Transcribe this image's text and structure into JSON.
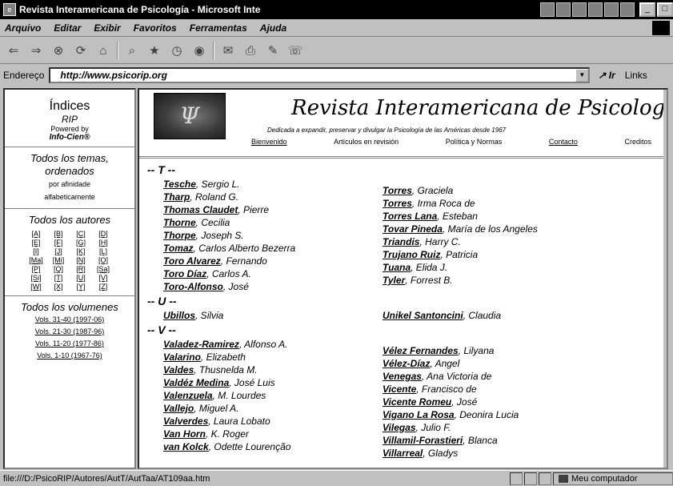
{
  "window": {
    "title": "Revista Interamericana de Psicología - Microsoft Inte",
    "controls": [
      "_",
      "□"
    ]
  },
  "menu": [
    "Arquivo",
    "Editar",
    "Exibir",
    "Favoritos",
    "Ferramentas",
    "Ajuda"
  ],
  "toolbar": {
    "icons": [
      "back-icon",
      "forward-icon",
      "stop-icon",
      "refresh-icon",
      "home-icon",
      "search-icon",
      "favorites-icon",
      "history-icon",
      "media-icon",
      "mail-icon",
      "print-icon",
      "edit-icon",
      "discuss-icon"
    ]
  },
  "address": {
    "label": "Endereço",
    "url": "http://www.psicorip.org",
    "go": "Ir",
    "links": "Links"
  },
  "sidebar": {
    "title": "Índices",
    "subtitle": "RIP",
    "powered": "Powered by",
    "brand": "Info-Cien®",
    "themes_heading": "Todos los temas, ordenados",
    "themes_note1": "por afinidade",
    "themes_note2": "alfabeticamente",
    "authors_heading": "Todos los autores",
    "letters": [
      "[A]",
      "[B]",
      "[C]",
      "[D]",
      "[E]",
      "[F]",
      "[G]",
      "[H]",
      "[I]",
      "[J]",
      "[K]",
      "[L]",
      "[Ma]",
      "[Mi]",
      "[N]",
      "[O]",
      "[P]",
      "[Q]",
      "[R]",
      "[Sa]",
      "[Si]",
      "[T]",
      "[U]",
      "[V]",
      "[W]",
      "[X]",
      "[Y]",
      "[Z]"
    ],
    "volumes_heading": "Todos los volumenes",
    "volumes": [
      "Vols. 31-40 (1997-06)",
      "Vols. 21-30 (1987-96)",
      "Vols. 11-20 (1977-86)",
      "Vols. 1-10 (1967-76)"
    ]
  },
  "banner": {
    "logo": "Ψ",
    "title": "Revista Interamericana de Psicología",
    "tagline": "Dedicada a expandir, preservar y divulgar la Psicología de las Américas desde 1967",
    "nav": [
      "Bienvenido",
      "Artículos en revisión",
      "Política y Normas",
      "Contacto",
      "Creditos"
    ]
  },
  "sections": [
    {
      "letter": "-- T --",
      "left": [
        {
          "surname": "Tesche",
          "given": ", Sergio L."
        },
        {
          "surname": "Tharp",
          "given": ", Roland G."
        },
        {
          "surname": "Thomas Claudet",
          "given": ", Pierre"
        },
        {
          "surname": "Thorne",
          "given": ", Cecilia"
        },
        {
          "surname": "Thorpe",
          "given": ", Joseph S."
        },
        {
          "surname": "Tomaz",
          "given": ", Carlos Alberto Bezerra"
        },
        {
          "surname": "Toro Alvarez",
          "given": ", Fernando"
        },
        {
          "surname": "Toro Díaz",
          "given": ", Carlos A."
        },
        {
          "surname": "Toro-Alfonso",
          "given": ", José"
        }
      ],
      "right": [
        {
          "surname": "Torres",
          "given": ", Graciela"
        },
        {
          "surname": "Torres",
          "given": ", Irma Roca de"
        },
        {
          "surname": "Torres Lana",
          "given": ", Esteban"
        },
        {
          "surname": "Tovar Pineda",
          "given": ", María de los Angeles"
        },
        {
          "surname": "Triandis",
          "given": ", Harry C."
        },
        {
          "surname": "Trujano Ruiz",
          "given": ", Patricia"
        },
        {
          "surname": "Tuana",
          "given": ", Elida J."
        },
        {
          "surname": "Tyler",
          "given": ", Forrest B."
        }
      ]
    },
    {
      "letter": "-- U --",
      "left": [
        {
          "surname": "Ubillos",
          "given": ", Silvia"
        }
      ],
      "right": [
        {
          "surname": "Unikel Santoncini",
          "given": ", Claudia"
        }
      ]
    },
    {
      "letter": "-- V --",
      "left": [
        {
          "surname": "Valadez-Ramirez",
          "given": ", Alfonso A."
        },
        {
          "surname": "Valarino",
          "given": ", Elizabeth"
        },
        {
          "surname": "Valdes",
          "given": ", Thusnelda M."
        },
        {
          "surname": "Valdéz Medina",
          "given": ", José Luis"
        },
        {
          "surname": "Valenzuela",
          "given": ", M. Lourdes"
        },
        {
          "surname": "Vallejo",
          "given": ", Miguel A."
        },
        {
          "surname": "Valverdes",
          "given": ", Laura Lobato"
        },
        {
          "surname": "Van Horn",
          "given": ", K. Roger"
        },
        {
          "surname": "van Kolck",
          "given": ", Odette Lourenção"
        }
      ],
      "right": [
        {
          "surname": "Vélez Fernandes",
          "given": ", Lilyana"
        },
        {
          "surname": "Vélez-Díaz",
          "given": ", Angel"
        },
        {
          "surname": "Venegas",
          "given": ", Ana Victoria de"
        },
        {
          "surname": "Vicente",
          "given": ", Francisco de"
        },
        {
          "surname": "Vicente Romeu",
          "given": ", José"
        },
        {
          "surname": "Vigano La Rosa",
          "given": ", Deonira Lucia"
        },
        {
          "surname": "Vilegas",
          "given": ", Julio F."
        },
        {
          "surname": "Villamil-Forastieri",
          "given": ", Blanca"
        },
        {
          "surname": "Villarreal",
          "given": ", Gladys"
        }
      ]
    }
  ],
  "status": {
    "text": "file:///D:/PsicoRIP/Autores/AutT/AutTaa/AT109aa.htm",
    "zone": "Meu computador"
  }
}
